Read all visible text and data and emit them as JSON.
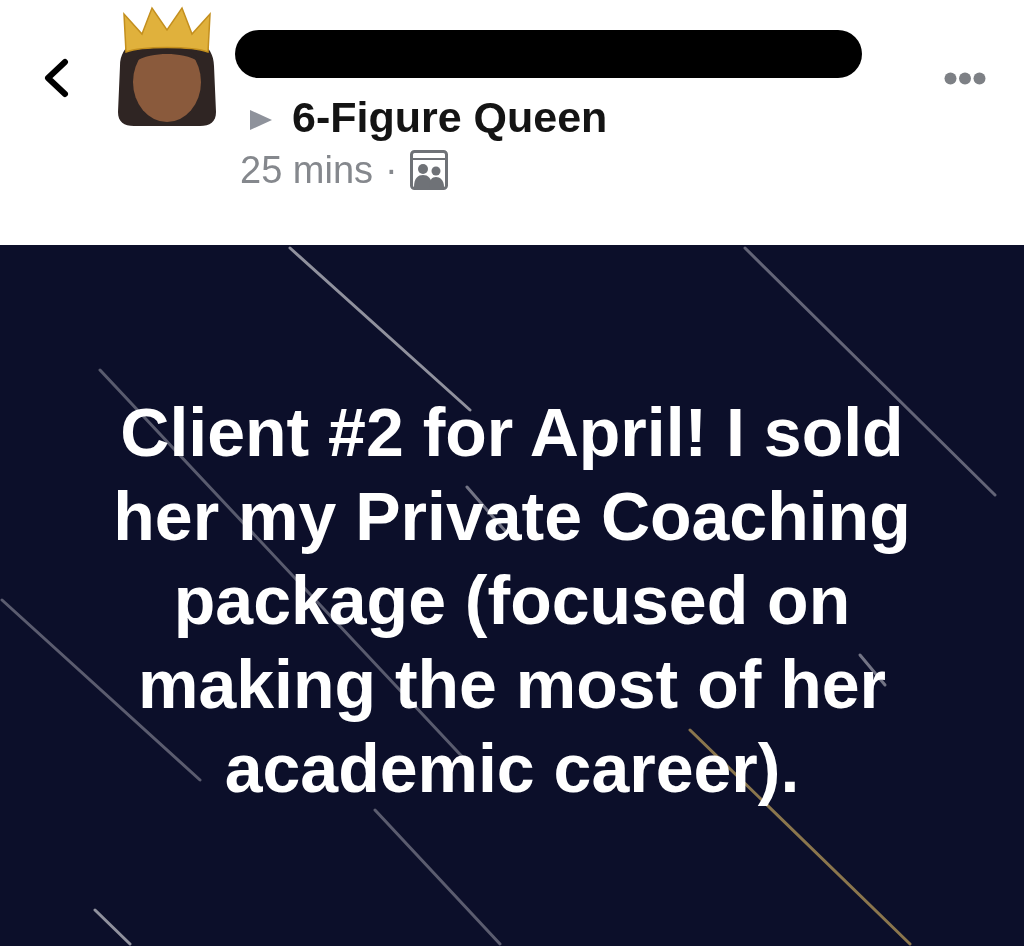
{
  "author": {
    "redacted": true
  },
  "group": {
    "name": "6-Figure Queen"
  },
  "meta": {
    "time": "25 mins",
    "separator": "·"
  },
  "post": {
    "text": "Client #2 for April! I sold her my Private Coaching package (focused on making the most of her academic career)."
  }
}
